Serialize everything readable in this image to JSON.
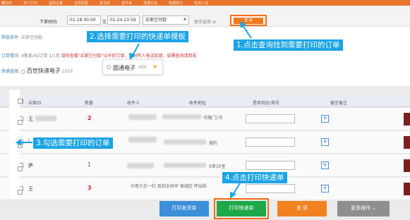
{
  "nav": {
    "items": [
      "量打印",
      "单个打印",
      "基础设置",
      "全局配置",
      "发货单",
      "查件单",
      "我要拉货",
      "数据统计",
      "实用工具"
    ]
  },
  "toolbar": {
    "time_label": "下单时间:",
    "date_start": "01-18 00:00",
    "date_sep": "至",
    "date_end": "01-24 23:59",
    "status_value": "买家已付款",
    "more_filter": "更多选项 ≫",
    "query_label": "查 询"
  },
  "info": {
    "filter_label": "筛选条件:",
    "filter_value": "买家已付款",
    "order_label": "订单情况:",
    "order_value": "4笔某/42订单  1/1页",
    "order_notice": "目前查看\"买家已付款\"以外的订单，请对所人电话如那，如需查询请双击",
    "express_label": "快递选择:",
    "express_name": "百世快递电子",
    "express_count": "1018"
  },
  "template_popup": {
    "name": "圆通电子",
    "count": "484",
    "star": "★"
  },
  "callouts": {
    "c1": "1.点击查询找到需要打印的订单",
    "c2": "2.选择需要打印的快递单模板",
    "c3": "3.勾选需要打印的订单",
    "c4": "4.点击打印快递单"
  },
  "table": {
    "headers": {
      "buyer": "买家ID",
      "qty": "数量",
      "recipient": "收件人",
      "address": "收件地址",
      "tracking": "是否到达/单号",
      "remark": "留言备注"
    },
    "rows": [
      {
        "buyer": "王",
        "qty": "2",
        "qty_red": true,
        "addr": "号路门1号"
      },
      {
        "buyer": "l",
        "qty": "1",
        "qty_red": false,
        "addr": "搜利"
      },
      {
        "buyer": "萨",
        "qty": "1",
        "qty_red": false,
        "addr": "9单30室"
      },
      {
        "buyer": "王",
        "qty": "3",
        "qty_red": true,
        "addr": "中意大在一约 现和太林市 宿城区 怀仙阳"
      }
    ]
  },
  "actions": {
    "print_ship": "打印发货单",
    "print_express": "打印快递单",
    "ship": "发 货",
    "more": "更多操作 ⌄"
  },
  "colors": {
    "nav_bg": "#e8732b",
    "callout_bg": "#1aa3e6",
    "highlight_border": "#ff6b10"
  }
}
